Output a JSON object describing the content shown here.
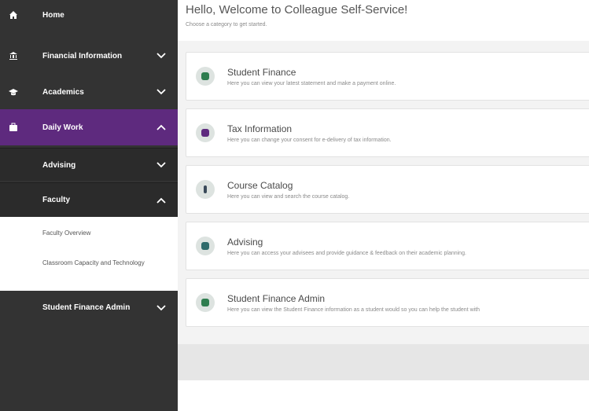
{
  "colors": {
    "sidebar_bg": "#333333",
    "active_bg": "#5e2a7e",
    "sub_bg": "#2b2b2b"
  },
  "sidebar": {
    "items": [
      {
        "label": "Home",
        "icon": "home-icon"
      },
      {
        "label": "Financial Information",
        "icon": "bank-icon",
        "chevron": "down"
      },
      {
        "label": "Academics",
        "icon": "graduation-cap-icon",
        "chevron": "down"
      },
      {
        "label": "Daily Work",
        "icon": "briefcase-icon",
        "chevron": "up",
        "active": true
      }
    ],
    "daily_work_children": [
      {
        "label": "Advising",
        "chevron": "down"
      },
      {
        "label": "Faculty",
        "chevron": "up"
      }
    ],
    "faculty_children": [
      {
        "label": "Faculty Overview"
      },
      {
        "label": "Classroom Capacity and Technology"
      }
    ],
    "finance_admin": {
      "label": "Student Finance Admin",
      "chevron": "down"
    }
  },
  "main": {
    "greeting": "Hello, Welcome to Colleague Self-Service!",
    "subtitle": "Choose a category to get started.",
    "cards": [
      {
        "title": "Student Finance",
        "desc": "Here you can view your latest statement and make a payment online.",
        "icon": "finance-icon",
        "icon_color": "#2e7d4f"
      },
      {
        "title": "Tax Information",
        "desc": "Here you can change your consent for e-delivery of tax information.",
        "icon": "tax-icon",
        "icon_color": "#5e2a7e"
      },
      {
        "title": "Course Catalog",
        "desc": "Here you can view and search the course catalog.",
        "icon": "catalog-icon",
        "icon_color": "#3a4a5a"
      },
      {
        "title": "Advising",
        "desc": "Here you can access your advisees and provide guidance & feedback on their academic planning.",
        "icon": "advising-icon",
        "icon_color": "#2f6b6b"
      },
      {
        "title": "Student Finance Admin",
        "desc": "Here you can view the Student Finance information as a student would so you can help the student with",
        "icon": "finance-admin-icon",
        "icon_color": "#2e7d4f"
      }
    ]
  }
}
